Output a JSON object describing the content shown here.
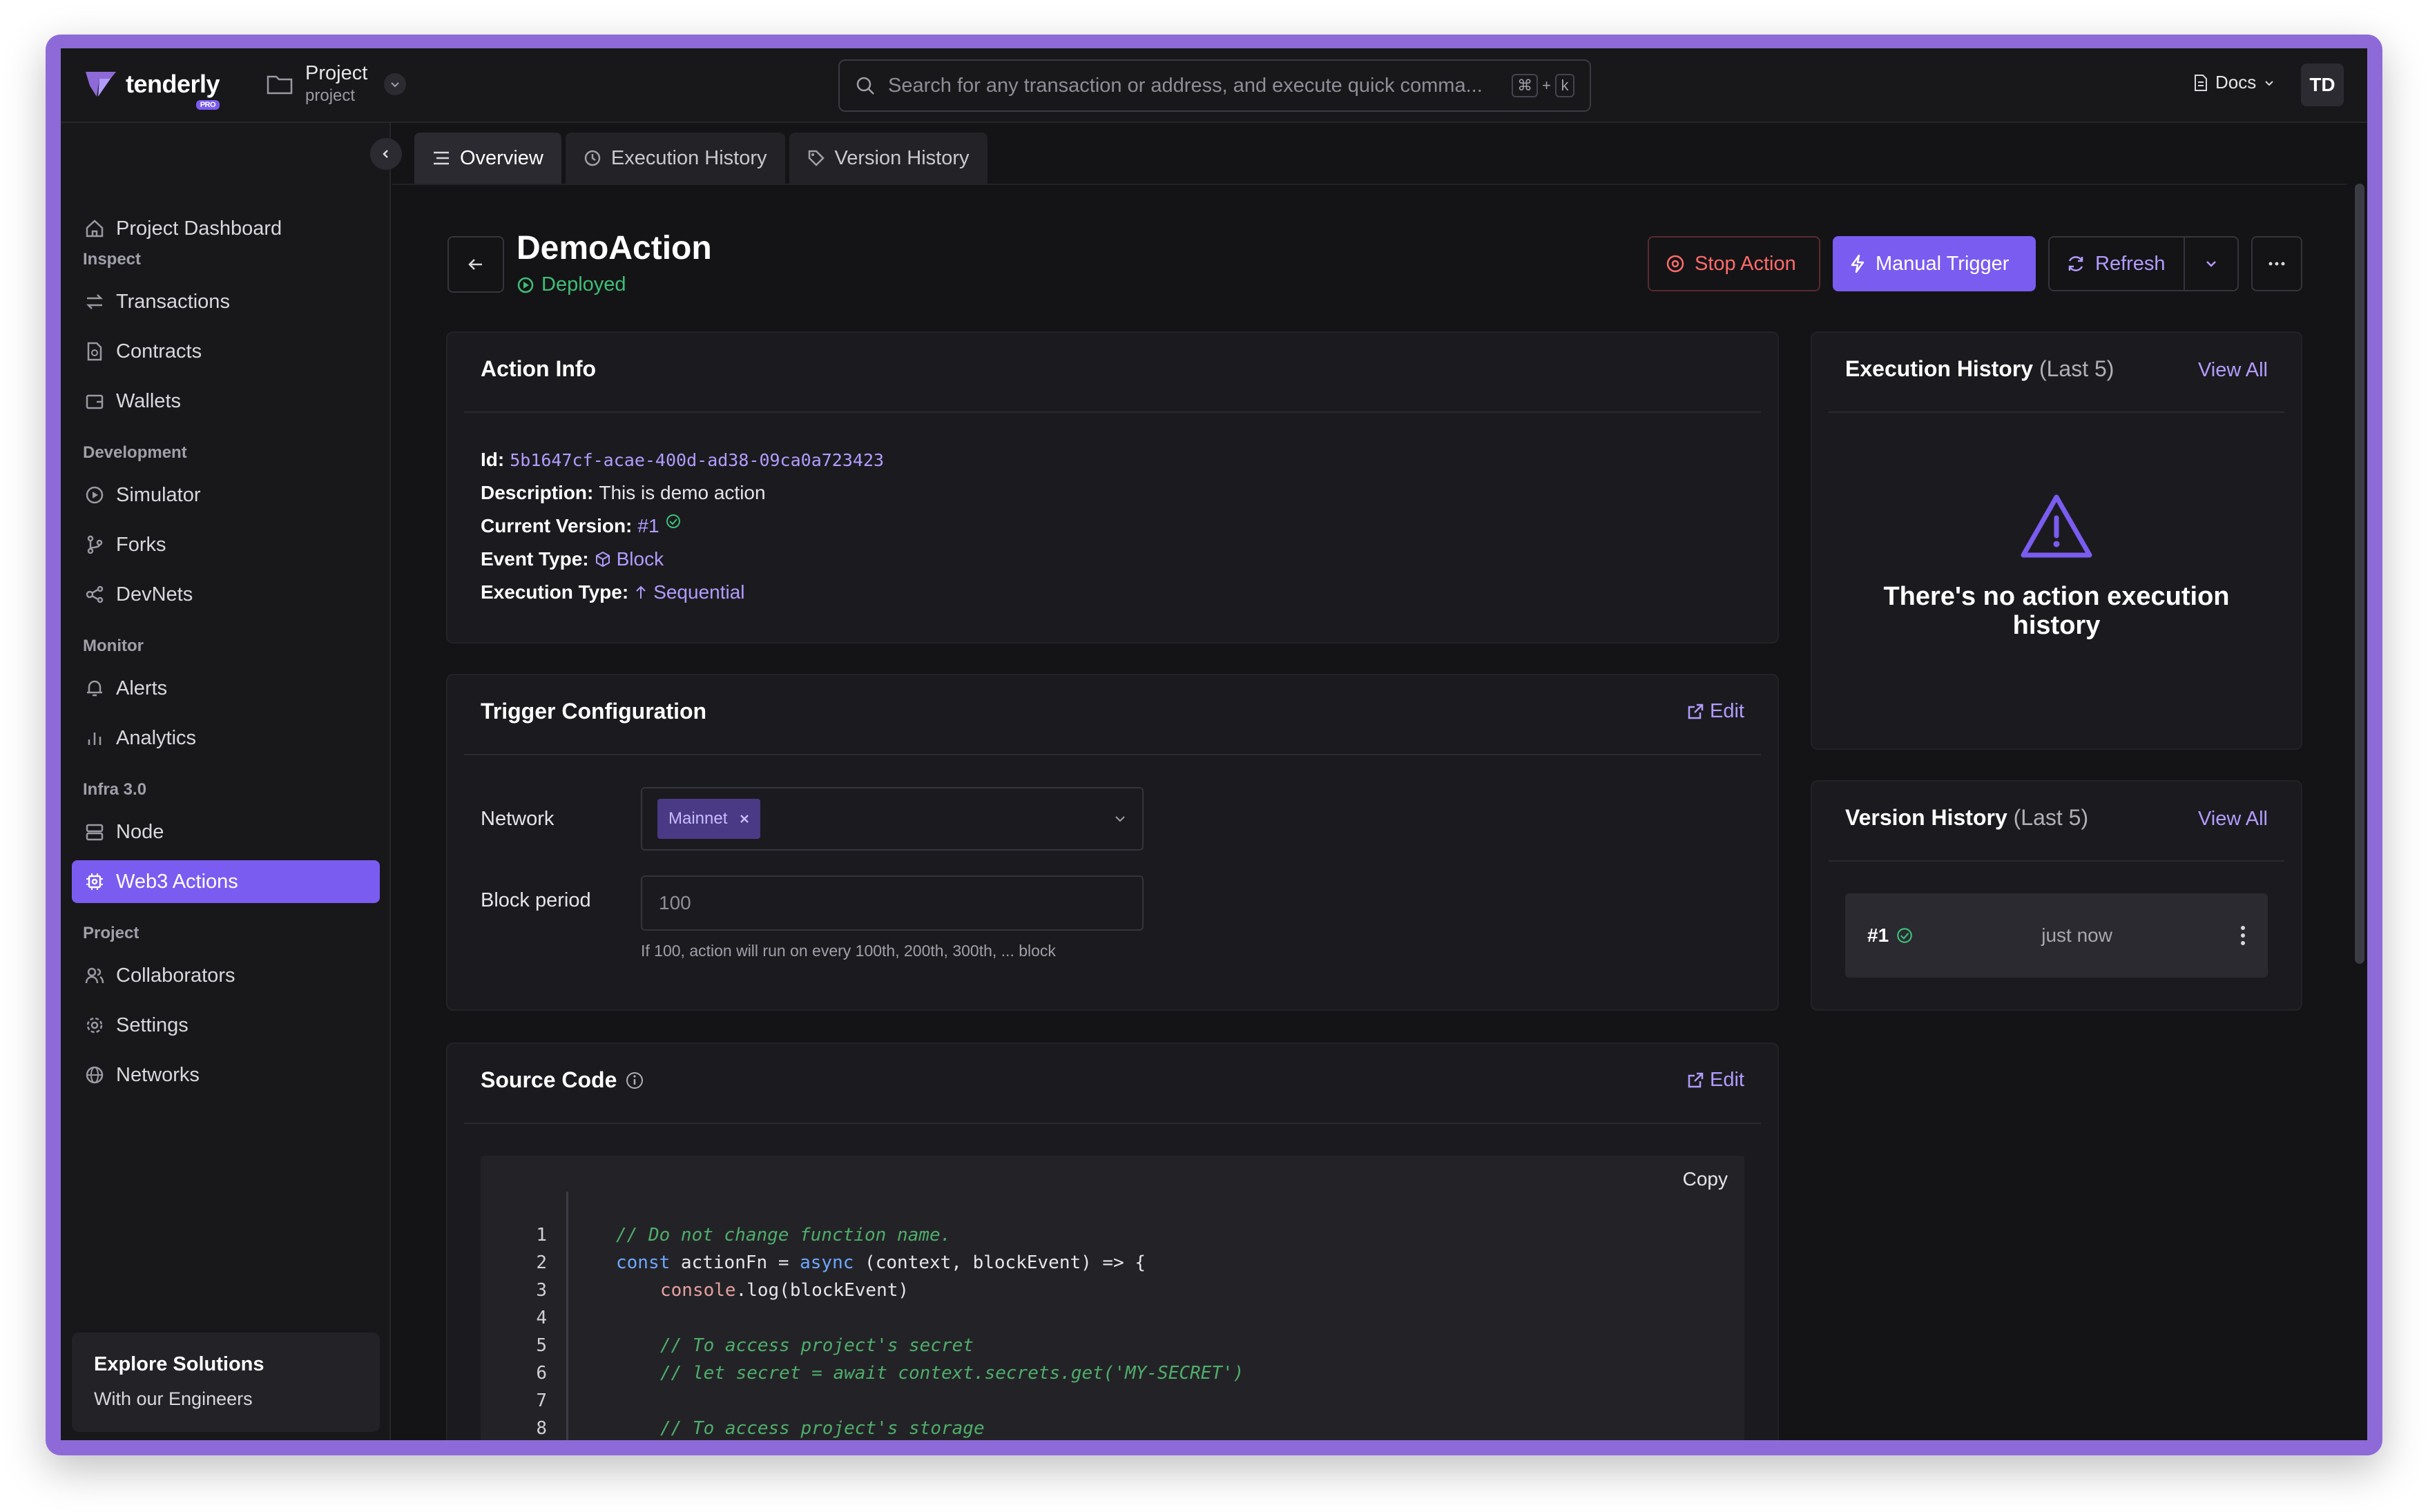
{
  "brand": {
    "name": "tenderly",
    "badge": "PRO"
  },
  "project": {
    "label": "Project",
    "name": "project"
  },
  "search": {
    "placeholder": "Search for any transaction or address, and execute quick comma...",
    "shortcut_cmd": "⌘",
    "shortcut_plus": "+",
    "shortcut_key": "k"
  },
  "topbar": {
    "docs": "Docs",
    "avatar": "TD"
  },
  "sidebar": {
    "dashboard": "Project Dashboard",
    "sections": [
      "Inspect",
      "Development",
      "Monitor",
      "Infra 3.0",
      "Project"
    ],
    "items": [
      "Transactions",
      "Contracts",
      "Wallets",
      "Simulator",
      "Forks",
      "DevNets",
      "Alerts",
      "Analytics",
      "Node",
      "Web3 Actions",
      "Collaborators",
      "Settings",
      "Networks"
    ],
    "explore_title": "Explore Solutions",
    "explore_sub": "With our Engineers"
  },
  "tabs": [
    "Overview",
    "Execution History",
    "Version History"
  ],
  "header": {
    "title": "DemoAction",
    "status": "Deployed",
    "stop": "Stop Action",
    "trigger": "Manual Trigger",
    "refresh": "Refresh"
  },
  "action_info": {
    "title": "Action Info",
    "id_label": "Id:",
    "id_value": "5b1647cf-acae-400d-ad38-09ca0a723423",
    "desc_label": "Description:",
    "desc_value": "This is demo action",
    "version_label": "Current Version:",
    "version_value": "#1",
    "event_label": "Event Type:",
    "event_value": "Block",
    "exec_label": "Execution Type:",
    "exec_value": "Sequential"
  },
  "trigger": {
    "title": "Trigger Configuration",
    "edit": "Edit",
    "network_label": "Network",
    "network_value": "Mainnet",
    "period_label": "Block period",
    "period_placeholder": "100",
    "hint": "If 100, action will run on every 100th, 200th, 300th, ... block"
  },
  "source": {
    "title": "Source Code",
    "edit": "Edit",
    "copy": "Copy",
    "line_numbers": [
      "1",
      "2",
      "3",
      "4",
      "5",
      "6",
      "7",
      "8"
    ],
    "l1": "// Do not change function name.",
    "l2a": "const",
    "l2b": " actionFn = ",
    "l2c": "async",
    "l2d": " (context, blockEvent) => {",
    "l3a": "console",
    "l3b": ".log(blockEvent)",
    "l5": "// To access project's secret",
    "l6": "// let secret = await context.secrets.get('MY-SECRET')",
    "l8": "// To access project's storage"
  },
  "exec_history": {
    "title": "Execution History",
    "subtitle": "(Last 5)",
    "view_all": "View All",
    "empty": "There's no action execution history"
  },
  "version_history": {
    "title": "Version History",
    "subtitle": "(Last 5)",
    "view_all": "View All",
    "row_version": "#1",
    "row_time": "just now"
  },
  "colors": {
    "accent": "#7b5cf0",
    "accent_text": "#b39cff",
    "success": "#3fbf78",
    "danger": "#ff6b6b",
    "background": "#141416"
  }
}
